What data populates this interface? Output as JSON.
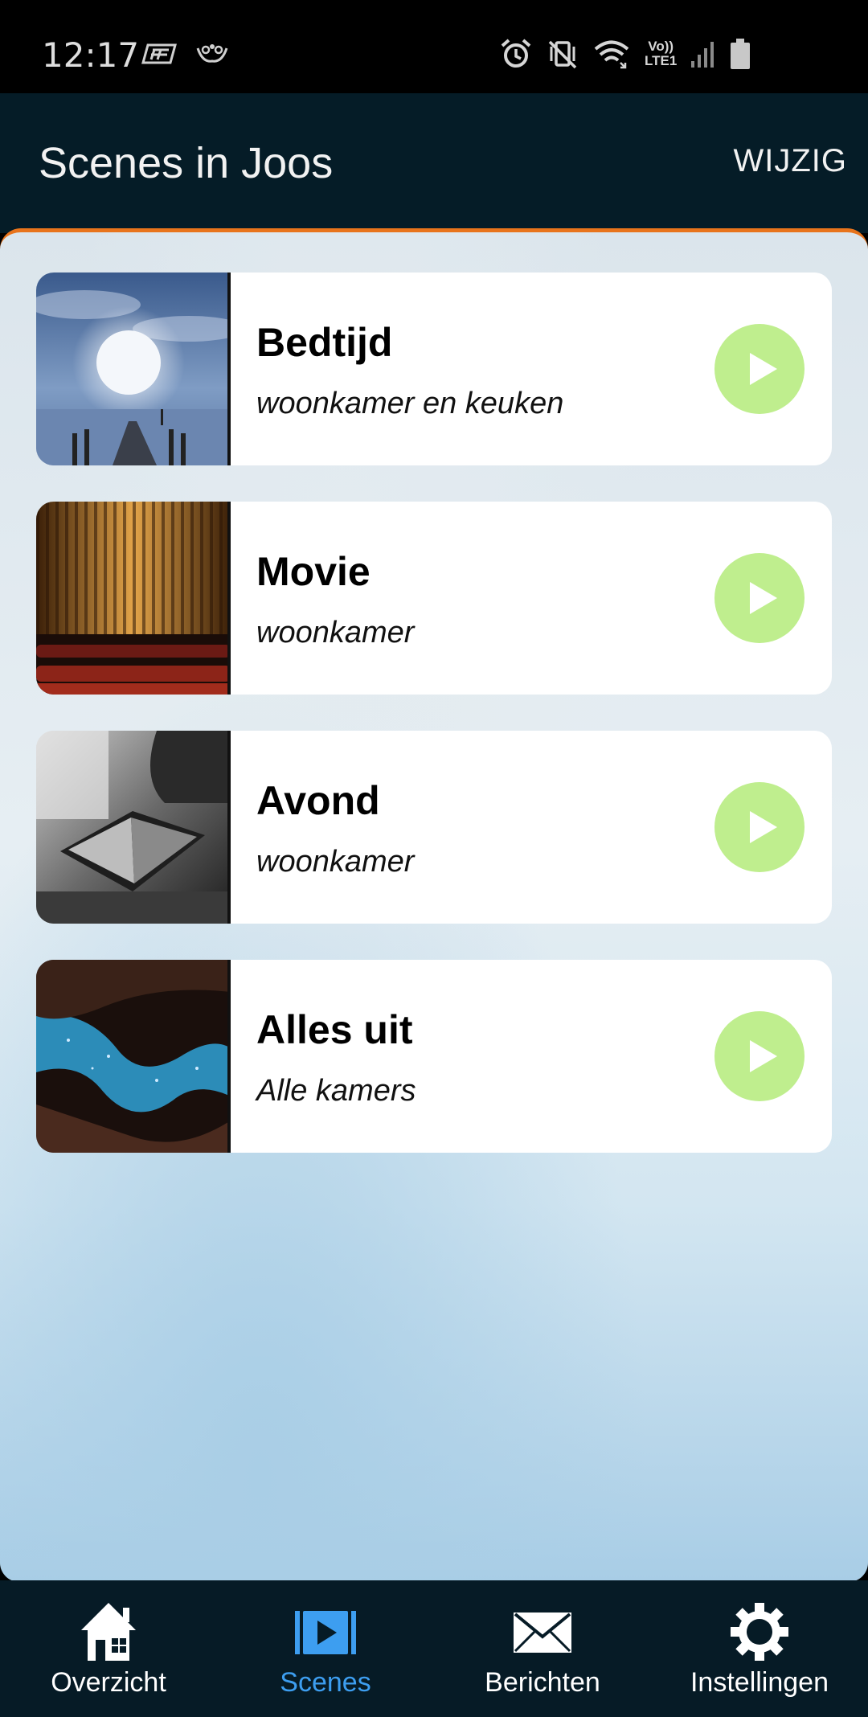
{
  "status_bar": {
    "time": "12:17",
    "lte_top": "Vo))",
    "lte_bottom": "LTE1",
    "icons": [
      "app-icon-1",
      "app-icon-2",
      "alarm-icon",
      "vibrate-icon",
      "wifi-icon",
      "lte-icon",
      "signal-icon",
      "battery-icon"
    ]
  },
  "header": {
    "title": "Scenes in Joos",
    "edit_label": "WIJZIG"
  },
  "theme": {
    "accent_orange": "#e8741c",
    "header_bg": "#051c27",
    "play_green": "#bfee8e",
    "nav_active": "#3d9ef0"
  },
  "scenes": [
    {
      "name": "Bedtijd",
      "rooms": "woonkamer en keuken",
      "thumbnail": "moon-pier"
    },
    {
      "name": "Movie",
      "rooms": "woonkamer",
      "thumbnail": "cinema-curtain"
    },
    {
      "name": "Avond",
      "rooms": "woonkamer",
      "thumbnail": "book-reading"
    },
    {
      "name": "Alles uit",
      "rooms": "Alle kamers",
      "thumbnail": "canyon-stars"
    }
  ],
  "nav": {
    "items": [
      {
        "label": "Overzicht",
        "icon": "home-icon",
        "active": false
      },
      {
        "label": "Scenes",
        "icon": "play-screen-icon",
        "active": true
      },
      {
        "label": "Berichten",
        "icon": "envelope-icon",
        "active": false
      },
      {
        "label": "Instellingen",
        "icon": "gear-icon",
        "active": false
      }
    ]
  }
}
